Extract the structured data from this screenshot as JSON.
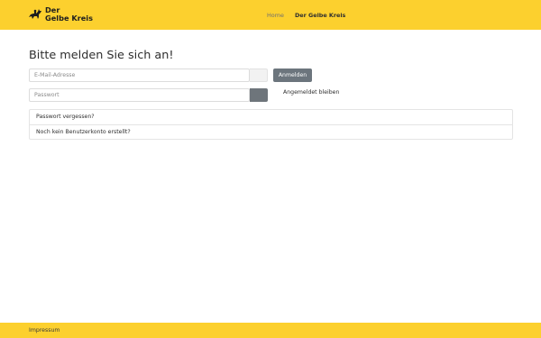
{
  "header": {
    "logo": {
      "line1": "Der",
      "line2": "Gelbe Kreis",
      "icon": "horse-rider-icon"
    },
    "nav": [
      {
        "label": "Home"
      },
      {
        "label": "Der Gelbe Kreis"
      }
    ],
    "accent_color": "#fcd02e"
  },
  "login": {
    "title": "Bitte melden Sie sich an!",
    "email_placeholder": "E-Mail-Adresse",
    "password_placeholder": "Passwort",
    "submit_label": "Anmelden",
    "remember_label": "Angemeldet bleiben"
  },
  "links": [
    {
      "label": "Passwort vergessen?"
    },
    {
      "label": "Noch kein Benutzerkonto erstellt?"
    }
  ],
  "footer": {
    "impressum": "Impressum"
  }
}
